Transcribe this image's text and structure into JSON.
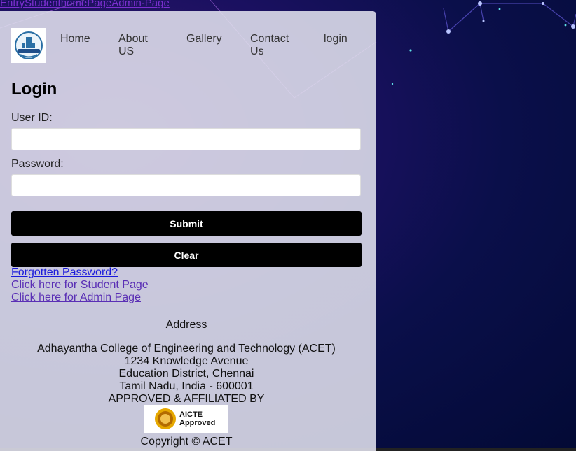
{
  "top_links": "EntryStudenthomePageAdmin-Page",
  "nav": {
    "logo_alt": "University logo",
    "items": [
      {
        "label": "Home"
      },
      {
        "label": "About\nUS"
      },
      {
        "label": "Gallery"
      },
      {
        "label": "Contact\nUs"
      },
      {
        "label": "login"
      }
    ]
  },
  "form": {
    "title": "Login",
    "user_label": "User ID:",
    "user_value": "",
    "password_label": "Password:",
    "password_value": "",
    "submit_label": "Submit",
    "clear_label": "Clear"
  },
  "links": {
    "forgot": "Forgotten Password?",
    "student": "Click here for Student Page",
    "admin": "Click here for Admin Page"
  },
  "footer": {
    "heading": "Address",
    "line1": "Adhayantha College of Engineering and Technology (ACET)",
    "line2": "1234 Knowledge Avenue",
    "line3": "Education District, Chennai",
    "line4": "Tamil Nadu, India - 600001",
    "line5": "APPROVED & AFFILIATED BY",
    "badge_line1": "AICTE",
    "badge_line2": "Approved",
    "copyright": "Copyright © ACET"
  },
  "colors": {
    "background": "#0a0f4a",
    "panel": "#e1e1ee",
    "button": "#000000",
    "link": "#5a2fb5"
  }
}
